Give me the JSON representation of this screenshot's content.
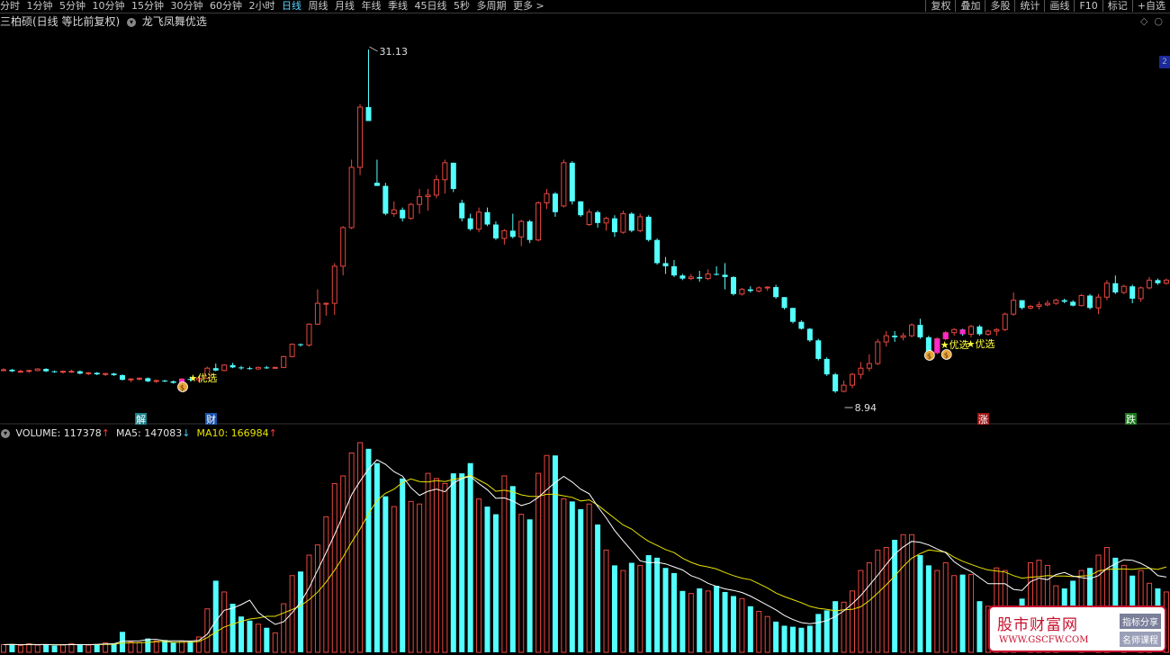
{
  "toolbar": {
    "periods": [
      "分时",
      "1分钟",
      "5分钟",
      "10分钟",
      "15分钟",
      "30分钟",
      "60分钟",
      "2小时",
      "日线",
      "周线",
      "月线",
      "年线",
      "季线",
      "45日线",
      "5秒",
      "多周期",
      "更多 >"
    ],
    "active_period": "日线",
    "tools": [
      "复权",
      "叠加",
      "多股",
      "统计",
      "画线",
      "F10",
      "标记",
      "+自选"
    ]
  },
  "title": {
    "stock": "三柏硕(日线 等比前复权)",
    "indicator": "龙飞凤舞优选"
  },
  "annotations": {
    "high_label": "31.13",
    "low_label": "8.94",
    "signal_text": "优选",
    "signal_star": "★",
    "event_jie": "解",
    "event_cai": "财",
    "event_zhang": "涨",
    "event_die": "跌",
    "rt_badge": "2"
  },
  "volume": {
    "vol_label": "VOLUME:",
    "vol_value": "117378",
    "vol_dir": "↑",
    "ma5_label": "MA5:",
    "ma5_value": "147083",
    "ma5_dir": "↓",
    "ma10_label": "MA10:",
    "ma10_value": "166984",
    "ma10_dir": "↑"
  },
  "colors": {
    "up": "#e8473f",
    "down": "#54ffff",
    "ma5": "#ffffff",
    "ma10": "#e8e300",
    "signal": "#ff28c8",
    "label": "#ffff40"
  },
  "watermark": {
    "title": "股市财富网",
    "url": "WWW.GSCFW.COM",
    "tag1": "指标分享",
    "tag2": "名师课程"
  },
  "chart_data": {
    "type": "candlestick",
    "ohlc": [
      [
        10.4,
        10.5,
        10.3,
        10.4
      ],
      [
        10.4,
        10.45,
        10.25,
        10.3
      ],
      [
        10.3,
        10.4,
        10.2,
        10.3
      ],
      [
        10.3,
        10.4,
        10.2,
        10.35
      ],
      [
        10.35,
        10.5,
        10.3,
        10.45
      ],
      [
        10.45,
        10.5,
        10.25,
        10.3
      ],
      [
        10.3,
        10.35,
        10.2,
        10.25
      ],
      [
        10.25,
        10.35,
        10.15,
        10.3
      ],
      [
        10.3,
        10.4,
        10.2,
        10.3
      ],
      [
        10.3,
        10.35,
        10.1,
        10.15
      ],
      [
        10.15,
        10.25,
        10.05,
        10.2
      ],
      [
        10.2,
        10.25,
        10.05,
        10.1
      ],
      [
        10.1,
        10.2,
        10.0,
        10.15
      ],
      [
        10.15,
        10.2,
        10.0,
        10.05
      ],
      [
        10.05,
        10.1,
        9.7,
        9.75
      ],
      [
        9.75,
        9.85,
        9.6,
        9.8
      ],
      [
        9.8,
        9.9,
        9.7,
        9.85
      ],
      [
        9.85,
        9.9,
        9.6,
        9.65
      ],
      [
        9.65,
        9.75,
        9.55,
        9.7
      ],
      [
        9.7,
        9.75,
        9.6,
        9.65
      ],
      [
        9.65,
        9.7,
        9.5,
        9.55
      ],
      [
        9.55,
        9.85,
        9.5,
        9.8
      ],
      [
        9.8,
        9.95,
        9.65,
        9.75
      ],
      [
        9.75,
        9.9,
        9.6,
        9.85
      ],
      [
        9.85,
        10.6,
        9.8,
        10.5
      ],
      [
        10.5,
        10.8,
        10.3,
        10.35
      ],
      [
        10.35,
        10.75,
        10.3,
        10.7
      ],
      [
        10.7,
        10.85,
        10.5,
        10.55
      ],
      [
        10.55,
        10.65,
        10.4,
        10.5
      ],
      [
        10.5,
        10.6,
        10.4,
        10.45
      ],
      [
        10.45,
        10.6,
        10.4,
        10.55
      ],
      [
        10.55,
        10.65,
        10.45,
        10.5
      ],
      [
        10.5,
        10.6,
        10.45,
        10.55
      ],
      [
        10.55,
        11.3,
        10.5,
        11.25
      ],
      [
        11.25,
        12.1,
        11.2,
        12.05
      ],
      [
        12.05,
        12.1,
        11.9,
        12.0
      ],
      [
        12.0,
        13.4,
        11.9,
        13.35
      ],
      [
        13.35,
        15.6,
        13.3,
        14.7
      ],
      [
        14.7,
        14.75,
        13.9,
        14.7
      ],
      [
        14.7,
        17.3,
        13.95,
        17.1
      ],
      [
        17.1,
        19.7,
        16.5,
        19.6
      ],
      [
        19.6,
        24.0,
        19.5,
        23.5
      ],
      [
        23.5,
        27.6,
        23.0,
        27.4
      ],
      [
        27.4,
        31.13,
        26.5,
        26.5
      ],
      [
        22.5,
        24.0,
        22.3,
        22.3
      ],
      [
        22.3,
        22.5,
        20.4,
        20.5
      ],
      [
        20.5,
        21.3,
        20.3,
        20.75
      ],
      [
        20.75,
        20.9,
        20.0,
        20.2
      ],
      [
        20.2,
        21.2,
        20.1,
        21.1
      ],
      [
        21.1,
        22.1,
        20.5,
        21.6
      ],
      [
        21.6,
        22.1,
        20.7,
        21.7
      ],
      [
        21.7,
        23.0,
        21.5,
        22.7
      ],
      [
        22.7,
        24.0,
        21.8,
        23.8
      ],
      [
        23.8,
        23.8,
        21.9,
        22.1
      ],
      [
        21.2,
        21.4,
        20.0,
        20.2
      ],
      [
        20.2,
        20.5,
        19.4,
        19.5
      ],
      [
        19.5,
        20.9,
        19.3,
        20.6
      ],
      [
        20.6,
        20.9,
        19.7,
        19.8
      ],
      [
        19.8,
        20.0,
        18.8,
        18.9
      ],
      [
        18.9,
        19.5,
        18.5,
        19.4
      ],
      [
        19.4,
        20.5,
        18.9,
        19.0
      ],
      [
        19.0,
        20.1,
        18.4,
        20.0
      ],
      [
        20.0,
        20.1,
        18.6,
        18.8
      ],
      [
        18.8,
        21.3,
        18.7,
        21.2
      ],
      [
        21.2,
        22.1,
        20.8,
        21.8
      ],
      [
        21.8,
        21.9,
        20.3,
        20.6
      ],
      [
        21.0,
        24.0,
        20.9,
        23.8
      ],
      [
        23.8,
        23.9,
        21.1,
        21.3
      ],
      [
        21.3,
        21.3,
        20.3,
        20.4
      ],
      [
        19.8,
        20.8,
        19.7,
        20.6
      ],
      [
        20.6,
        20.7,
        19.6,
        19.9
      ],
      [
        19.9,
        20.3,
        19.4,
        20.2
      ],
      [
        20.2,
        20.4,
        19.0,
        19.3
      ],
      [
        19.3,
        20.7,
        19.2,
        20.5
      ],
      [
        20.5,
        20.6,
        19.3,
        19.4
      ],
      [
        19.4,
        20.5,
        19.3,
        20.3
      ],
      [
        20.3,
        20.4,
        18.7,
        18.8
      ],
      [
        18.8,
        18.9,
        17.2,
        17.3
      ],
      [
        17.3,
        17.7,
        16.6,
        17.1
      ],
      [
        17.1,
        17.5,
        16.4,
        16.5
      ],
      [
        16.5,
        16.6,
        16.2,
        16.3
      ],
      [
        16.3,
        16.6,
        16.2,
        16.4
      ],
      [
        16.4,
        16.8,
        16.1,
        16.3
      ],
      [
        16.3,
        16.9,
        16.2,
        16.6
      ],
      [
        16.6,
        17.1,
        16.5,
        16.55
      ],
      [
        16.55,
        17.3,
        15.6,
        16.4
      ],
      [
        16.4,
        16.45,
        15.2,
        15.3
      ],
      [
        15.3,
        15.7,
        15.2,
        15.6
      ],
      [
        15.6,
        15.8,
        15.4,
        15.5
      ],
      [
        15.5,
        15.8,
        15.4,
        15.7
      ],
      [
        15.7,
        15.8,
        15.5,
        15.75
      ],
      [
        15.75,
        15.9,
        15.0,
        15.1
      ],
      [
        15.1,
        15.1,
        14.3,
        14.4
      ],
      [
        14.4,
        14.4,
        13.4,
        13.5
      ],
      [
        13.5,
        13.6,
        13.0,
        13.05
      ],
      [
        13.05,
        13.1,
        12.2,
        12.3
      ],
      [
        12.3,
        12.4,
        11.0,
        11.1
      ],
      [
        11.1,
        11.2,
        10.0,
        10.1
      ],
      [
        10.1,
        10.2,
        8.9,
        9.0
      ],
      [
        9.0,
        9.7,
        8.94,
        9.4
      ],
      [
        9.4,
        10.2,
        9.2,
        10.1
      ],
      [
        10.1,
        10.9,
        9.8,
        10.5
      ],
      [
        10.5,
        11.4,
        10.3,
        10.8
      ],
      [
        10.8,
        12.4,
        10.7,
        12.2
      ],
      [
        12.2,
        12.9,
        11.9,
        12.6
      ],
      [
        12.6,
        12.9,
        12.2,
        12.5
      ],
      [
        12.5,
        12.8,
        12.3,
        12.6
      ],
      [
        12.6,
        13.4,
        12.5,
        13.3
      ],
      [
        13.3,
        13.7,
        12.4,
        12.5
      ],
      [
        12.5,
        12.6,
        11.4,
        11.5
      ],
      [
        11.5,
        12.5,
        11.4,
        12.4
      ],
      [
        12.4,
        12.9,
        12.3,
        12.8
      ],
      [
        12.8,
        13.1,
        12.6,
        13.0
      ],
      [
        13.0,
        13.05,
        12.6,
        12.7
      ],
      [
        12.7,
        13.3,
        12.5,
        13.2
      ],
      [
        13.2,
        13.3,
        12.6,
        12.7
      ],
      [
        12.7,
        13.0,
        12.6,
        12.9
      ],
      [
        12.9,
        13.1,
        12.6,
        13.0
      ],
      [
        13.0,
        14.1,
        12.9,
        14.0
      ],
      [
        14.0,
        15.4,
        13.9,
        14.9
      ],
      [
        14.9,
        14.9,
        14.3,
        14.4
      ],
      [
        14.4,
        14.6,
        14.3,
        14.5
      ],
      [
        14.5,
        14.8,
        14.3,
        14.6
      ],
      [
        14.6,
        14.9,
        14.5,
        14.7
      ],
      [
        14.7,
        15.0,
        14.6,
        14.9
      ],
      [
        14.9,
        15.0,
        14.7,
        14.8
      ],
      [
        14.8,
        14.9,
        14.5,
        14.55
      ],
      [
        14.55,
        15.3,
        14.5,
        15.2
      ],
      [
        15.2,
        15.3,
        14.3,
        14.4
      ],
      [
        14.4,
        15.3,
        14.0,
        15.1
      ],
      [
        15.1,
        16.2,
        14.9,
        16.0
      ],
      [
        16.0,
        16.5,
        15.3,
        15.4
      ],
      [
        15.4,
        15.9,
        15.3,
        15.8
      ],
      [
        15.8,
        15.9,
        14.7,
        15.0
      ],
      [
        15.0,
        15.8,
        14.8,
        15.7
      ],
      [
        15.7,
        16.4,
        15.6,
        16.2
      ],
      [
        16.2,
        16.3,
        15.9,
        16.0
      ],
      [
        16.0,
        16.3,
        15.9,
        16.2
      ],
      [
        16.2,
        16.3,
        15.6,
        15.7
      ],
      [
        15.7,
        15.8,
        15.2,
        15.3
      ],
      [
        15.3,
        15.4,
        14.0,
        14.1
      ]
    ],
    "volume": [
      15000,
      16000,
      13500,
      16500,
      14000,
      15500,
      13000,
      14500,
      17000,
      15500,
      14000,
      16000,
      18500,
      17500,
      40000,
      20000,
      19000,
      27000,
      22000,
      24000,
      19000,
      22000,
      21000,
      30000,
      85000,
      140000,
      118000,
      95000,
      70000,
      62000,
      55000,
      48000,
      38000,
      95000,
      150000,
      158000,
      190000,
      210000,
      265000,
      330000,
      345000,
      390000,
      410000,
      398000,
      370000,
      305000,
      285000,
      340000,
      295000,
      290000,
      350000,
      340000,
      330000,
      350000,
      350000,
      370000,
      300000,
      285000,
      270000,
      345000,
      325000,
      270000,
      260000,
      350000,
      385000,
      385000,
      300000,
      295000,
      280000,
      290000,
      250000,
      200000,
      170000,
      160000,
      175000,
      170000,
      190000,
      185000,
      165000,
      155000,
      120000,
      115000,
      125000,
      120000,
      130000,
      118000,
      110000,
      105000,
      90000,
      80000,
      70000,
      60000,
      52000,
      50000,
      48000,
      52000,
      75000,
      82000,
      100000,
      98000,
      120000,
      160000,
      175000,
      200000,
      205000,
      220000,
      230000,
      230000,
      190000,
      170000,
      160000,
      175000,
      150000,
      152000,
      152000,
      100000,
      90000,
      165000,
      160000,
      85000,
      105000,
      175000,
      180000,
      170000,
      130000,
      125000,
      140000,
      160000,
      165000,
      190000,
      205000,
      185000,
      170000,
      150000,
      160000,
      135000,
      125000,
      118000
    ],
    "ma5": [
      15000,
      15500,
      14833,
      15250,
      15000,
      15100,
      14500,
      14700,
      15000,
      15000,
      15000,
      15400,
      16400,
      16700,
      21500,
      22200,
      22600,
      24800,
      25300,
      22400,
      22600,
      22500,
      22000,
      23200,
      35400,
      61600,
      82200,
      86400,
      93200,
      102000,
      78000,
      66000,
      54600,
      59600,
      77200,
      97800,
      126200,
      160600,
      194600,
      230600,
      268000,
      308000,
      334600,
      358600,
      376600,
      367800,
      353400,
      344600,
      321800,
      306800,
      315000,
      319200,
      314000,
      331000,
      340000,
      344000,
      330000,
      318000,
      301000,
      302000,
      296000,
      287000,
      292000,
      303000,
      318000,
      332000,
      344000,
      333000,
      319000,
      310000,
      285000,
      263000,
      238000,
      218000,
      199000,
      179000,
      175000,
      176000,
      173000,
      167000,
      161000,
      150000,
      144000,
      135000,
      129000,
      124000,
      121000,
      117000,
      110000,
      101000,
      92000,
      83000,
      72000,
      64000,
      58000,
      56000,
      58000,
      62000,
      70000,
      81000,
      95000,
      111000,
      131000,
      151000,
      172000,
      192000,
      206000,
      217000,
      215000,
      210000,
      202000,
      195000,
      177000,
      166000,
      158000,
      146000,
      134000,
      134000,
      134000,
      123000,
      121000,
      138000,
      145000,
      142000,
      152000,
      156000,
      149000,
      146000,
      144000,
      150000,
      164000,
      173000,
      181000,
      180000,
      174000,
      165000,
      150000,
      147083
    ],
    "ma10": [
      15000,
      15500,
      14833,
      15250,
      15000,
      15083,
      14857,
      14813,
      15056,
      15100,
      15000,
      15000,
      15500,
      15600,
      18200,
      18700,
      18600,
      19600,
      20600,
      21300,
      19400,
      19600,
      19700,
      21000,
      28700,
      39500,
      49400,
      55200,
      60500,
      65100,
      67100,
      70300,
      70400,
      77000,
      83600,
      91000,
      103000,
      117600,
      137000,
      160600,
      186400,
      215000,
      241000,
      271000,
      297000,
      311000,
      319000,
      332000,
      339000,
      334000,
      333000,
      336000,
      334000,
      338000,
      341000,
      346000,
      337000,
      328000,
      315000,
      317000,
      314000,
      308000,
      305000,
      305000,
      309000,
      309000,
      306000,
      303000,
      296000,
      298000,
      288000,
      275000,
      262000,
      249000,
      241000,
      228000,
      217000,
      209000,
      201000,
      195000,
      184000,
      176000,
      170000,
      167000,
      163000,
      156000,
      150000,
      145000,
      142000,
      134000,
      126000,
      116000,
      109000,
      103000,
      97000,
      90000,
      86000,
      84000,
      81000,
      83000,
      84000,
      89000,
      101000,
      116000,
      132000,
      149000,
      168000,
      184000,
      193000,
      200000,
      198000,
      196000,
      186000,
      178000,
      172000,
      166000,
      161000,
      159000,
      157000,
      150000,
      145000,
      147000,
      148000,
      150000,
      149000,
      149000,
      148000,
      149000,
      150000,
      159000,
      162000,
      163000,
      163000,
      162000,
      164000,
      164000,
      162000,
      166984
    ],
    "y_range_price": [
      8.94,
      31.13
    ],
    "grid": "off"
  }
}
